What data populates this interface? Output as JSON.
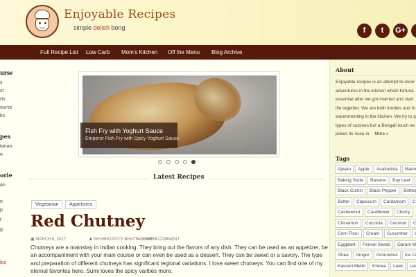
{
  "site": {
    "title": "Enjoyable Recipes",
    "tagline_pre": "simple ",
    "tagline_hl": "delish",
    "tagline_post": " bong",
    "logo_icon": "chef-face-logo"
  },
  "social": [
    {
      "name": "facebook-icon",
      "glyph": "f"
    },
    {
      "name": "twitter-icon",
      "glyph": "t"
    },
    {
      "name": "google-plus-icon",
      "glyph": "G+"
    },
    {
      "name": "extra-icon",
      "glyph": "f"
    }
  ],
  "nav": [
    "Full Recipe List",
    "Low Carb",
    "Mom's Kitchen",
    "Off the Menu",
    "Blog Archive"
  ],
  "left_col": [
    {
      "text": "urses",
      "style": "h"
    },
    {
      "text": "s",
      "style": ""
    },
    {
      "text": "st",
      "style": ""
    },
    {
      "text": "rts",
      "style": ""
    },
    {
      "text": "ourse",
      "style": ""
    },
    {
      "text": "ks",
      "style": ""
    },
    {
      "text": "pes",
      "style": "h"
    },
    {
      "text": "tarian",
      "style": ""
    },
    {
      "text": "n",
      "style": ""
    },
    {
      "text": "ories",
      "style": "h"
    },
    {
      "text": "an",
      "style": ""
    },
    {
      "text": "n",
      "style": ""
    },
    {
      "text": "p",
      "style": ""
    },
    {
      "text": "r",
      "style": ""
    },
    {
      "text": "g",
      "style": ""
    },
    {
      "text": "",
      "style": ""
    },
    {
      "text": "",
      "style": ""
    },
    {
      "text": "les",
      "style": "r"
    }
  ],
  "slider": {
    "caption_title": "Fish Fry with Yoghurt Sauce",
    "caption_sub": "Emperor Fish Fry with Spicy Yoghurt Sauce",
    "slide_count": 5,
    "active_index": 4
  },
  "latest": {
    "heading": "Latest Recipes",
    "categories": [
      "Vegetarian",
      "Appetizers"
    ],
    "post_title": "Red Chutney",
    "date": "MARCH 6, 2017",
    "author": "SHUBHOJYOTI BHATTACHARYA",
    "comment": "LEAVE A COMMENT",
    "excerpt": "Chutneys are a mainstay in Indian cooking. They bring out the flavors of any dish. They can be used as an appetizer, be an accompaniment with your main course or can even be used as a dessert. They can be sweet or a savory. The type and preparation of different chutneys has significant regional variations. I love sweet chutneys. You can find one of my eternal favorites here. Sumi loves the spicy varities more."
  },
  "sidebar": {
    "about_heading": "About",
    "about_lines": [
      "Enjoyable recipes is an attempt to recor",
      "adventures in the kitchen which fortuna",
      "essential after we got married and start",
      "life together. We are both foodies and fo",
      "experimenting in the kitchen. We try to g",
      "types of cuisines but a Bengali touch ee"
    ],
    "about_last": "pokes its nose in.",
    "more_label": "More »",
    "tags_heading": "Tags",
    "tag_rows": [
      [
        "Ajwain",
        "Apple",
        "Asafoetida",
        "Baking P"
      ],
      [
        "Baking Soda",
        "Banana",
        "Bay Leaf",
        "Be"
      ],
      [
        "Black Cumin",
        "Black Pepper",
        "Bottlego"
      ],
      [
        "Butter",
        "Capsicum",
        "Cardamom",
        "Carr"
      ],
      [
        "Cashewnut",
        "Cauliflower",
        "Cherry"
      ],
      [
        "Cinnamon",
        "Coccinia",
        "Coconut",
        "Coriand"
      ],
      [
        "Corn Flour",
        "Cream",
        "Cucumber",
        "Cur"
      ],
      [
        "Eggplant",
        "Fennel Seeds",
        "Garam Mas"
      ],
      [
        "Ghee",
        "Ginger",
        "Groundnut",
        "Ice Crea"
      ],
      [
        "Kasoori Methi",
        "Khowa",
        "Leek",
        "Lemo"
      ]
    ]
  }
}
